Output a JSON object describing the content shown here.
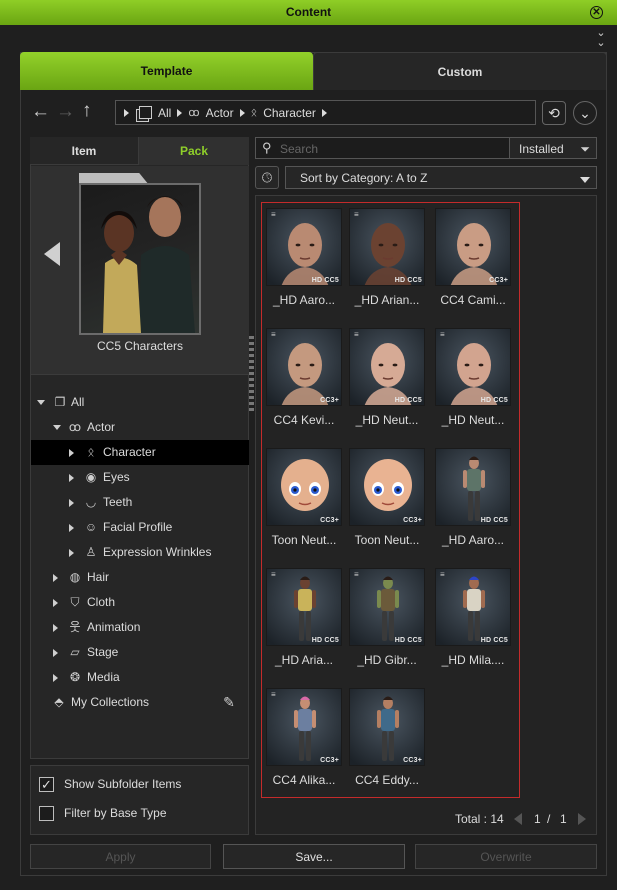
{
  "window": {
    "title": "Content"
  },
  "tabs": {
    "template": "Template",
    "custom": "Custom"
  },
  "breadcrumb": [
    "All",
    "Actor",
    "Character"
  ],
  "left": {
    "subtabs": {
      "item": "Item",
      "pack": "Pack"
    },
    "pack_name": "CC5 Characters",
    "tree": [
      {
        "label": "All",
        "icon": "all-icon",
        "state": "expanded"
      },
      {
        "label": "Actor",
        "icon": "actor-icon",
        "state": "expanded"
      },
      {
        "label": "Character",
        "icon": "character-icon",
        "state": "collapsed",
        "selected": true
      },
      {
        "label": "Eyes",
        "icon": "eye-icon",
        "state": "collapsed"
      },
      {
        "label": "Teeth",
        "icon": "teeth-icon",
        "state": "collapsed"
      },
      {
        "label": "Facial Profile",
        "icon": "facial-profile-icon",
        "state": "collapsed"
      },
      {
        "label": "Expression Wrinkles",
        "icon": "expression-wrinkles-icon",
        "state": "collapsed"
      },
      {
        "label": "Hair",
        "icon": "hair-icon",
        "state": "collapsed"
      },
      {
        "label": "Cloth",
        "icon": "cloth-icon",
        "state": "collapsed"
      },
      {
        "label": "Animation",
        "icon": "animation-icon",
        "state": "collapsed"
      },
      {
        "label": "Stage",
        "icon": "stage-icon",
        "state": "collapsed"
      },
      {
        "label": "Media",
        "icon": "media-icon",
        "state": "collapsed"
      },
      {
        "label": "My Collections",
        "icon": "collections-icon",
        "state": "none"
      }
    ],
    "options": [
      {
        "label": "Show Subfolder Items",
        "checked": true
      },
      {
        "label": "Filter by Base Type",
        "checked": false
      }
    ]
  },
  "search": {
    "placeholder": "Search",
    "filter": "Installed"
  },
  "sort": {
    "label": "Sort by Category: A to Z"
  },
  "items": [
    {
      "name": "_HD Aaro...",
      "badge": "HD CC5",
      "kind": "head",
      "skin": "#b98a72",
      "lines": true
    },
    {
      "name": "_HD Arian...",
      "badge": "HD CC5",
      "kind": "head",
      "skin": "#6b4231",
      "lines": true
    },
    {
      "name": "CC4 Cami...",
      "badge": "CC3+",
      "kind": "head",
      "skin": "#c99c84",
      "lines": false
    },
    {
      "name": "CC4 Kevi...",
      "badge": "CC3+",
      "kind": "head",
      "skin": "#c4997f",
      "lines": true
    },
    {
      "name": "_HD Neut...",
      "badge": "HD CC5",
      "kind": "head",
      "skin": "#d6aa95",
      "lines": true
    },
    {
      "name": "_HD Neut...",
      "badge": "HD CC5",
      "kind": "head",
      "skin": "#d2a48f",
      "lines": true
    },
    {
      "name": "Toon Neut...",
      "badge": "CC3+",
      "kind": "toon",
      "skin": "#e4b08e",
      "lines": false
    },
    {
      "name": "Toon Neut...",
      "badge": "CC3+",
      "kind": "toon",
      "skin": "#e9b392",
      "lines": false
    },
    {
      "name": "_HD Aaro...",
      "badge": "HD CC5",
      "kind": "body",
      "skin": "#b98a72",
      "cloth": "#5d7468",
      "lines": false
    },
    {
      "name": "_HD Aria...",
      "badge": "HD CC5",
      "kind": "body",
      "skin": "#6b4231",
      "cloth": "#c9b35a",
      "lines": true
    },
    {
      "name": "_HD Gibr...",
      "badge": "HD CC5",
      "kind": "body",
      "skin": "#7a8a4e",
      "cloth": "#6b5a3a",
      "lines": true
    },
    {
      "name": "_HD Mila....",
      "badge": "HD CC5",
      "kind": "body",
      "skin": "#a06b50",
      "cloth": "#d9d3c4",
      "hair": "#2d45c8",
      "lines": true
    },
    {
      "name": "CC4 Alika...",
      "badge": "CC3+",
      "kind": "body",
      "skin": "#c58e73",
      "cloth": "#6c7fa0",
      "hair": "#d96aa8",
      "lines": true
    },
    {
      "name": "CC4 Eddy...",
      "badge": "CC3+",
      "kind": "body",
      "skin": "#b47f62",
      "cloth": "#3f6a8a",
      "lines": false
    }
  ],
  "pager": {
    "total_label": "Total : 14",
    "page": "1",
    "sep": "/",
    "pages": "1"
  },
  "footer": {
    "apply": "Apply",
    "save": "Save...",
    "overwrite": "Overwrite"
  },
  "colors": {
    "accent": "#7dbd1c",
    "selection": "#c42b2b"
  }
}
